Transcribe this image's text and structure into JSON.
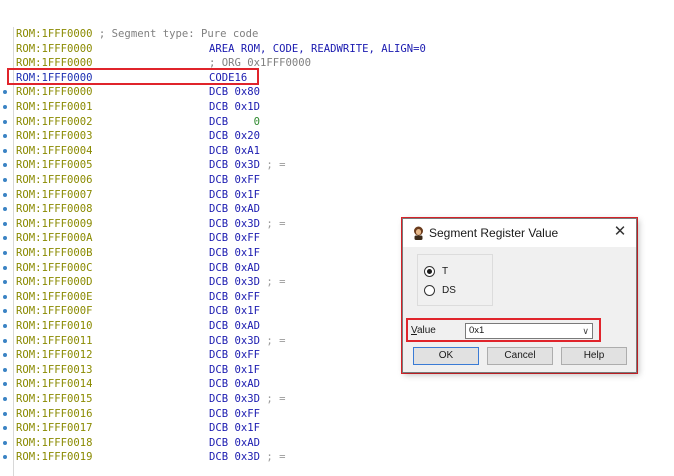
{
  "listing": {
    "lines": [
      {
        "addr": "ROM:1FFF0000",
        "rest_comment": " ; Segment type: ",
        "rest_extra": "Pure code",
        "dot": false
      },
      {
        "addr": "ROM:1FFF0000",
        "mnem": "AREA ROM, CODE, READWRITE, ALIGN=0",
        "dot": false
      },
      {
        "addr": "ROM:1FFF0000",
        "mnem_gray": "; ORG 0x1FFF0000",
        "dot": false
      },
      {
        "addr": "ROM:1FFF0000",
        "mnem": "CODE16",
        "dot": false,
        "selected": true
      },
      {
        "addr": "ROM:1FFF0000",
        "mnem": "DCB",
        "op": "0x80",
        "dot": true
      },
      {
        "addr": "ROM:1FFF0001",
        "mnem": "DCB",
        "op": "0x1D",
        "dot": true
      },
      {
        "addr": "ROM:1FFF0002",
        "mnem": "DCB",
        "op_sp": "   0",
        "dot": true
      },
      {
        "addr": "ROM:1FFF0003",
        "mnem": "DCB",
        "op": "0x20",
        "dot": true
      },
      {
        "addr": "ROM:1FFF0004",
        "mnem": "DCB",
        "op": "0xA1",
        "dot": true
      },
      {
        "addr": "ROM:1FFF0005",
        "mnem": "DCB",
        "op": "0x3D",
        "semi": " ; =",
        "dot": true
      },
      {
        "addr": "ROM:1FFF0006",
        "mnem": "DCB",
        "op": "0xFF",
        "dot": true
      },
      {
        "addr": "ROM:1FFF0007",
        "mnem": "DCB",
        "op": "0x1F",
        "dot": true
      },
      {
        "addr": "ROM:1FFF0008",
        "mnem": "DCB",
        "op": "0xAD",
        "dot": true
      },
      {
        "addr": "ROM:1FFF0009",
        "mnem": "DCB",
        "op": "0x3D",
        "semi": " ; =",
        "dot": true
      },
      {
        "addr": "ROM:1FFF000A",
        "mnem": "DCB",
        "op": "0xFF",
        "dot": true
      },
      {
        "addr": "ROM:1FFF000B",
        "mnem": "DCB",
        "op": "0x1F",
        "dot": true
      },
      {
        "addr": "ROM:1FFF000C",
        "mnem": "DCB",
        "op": "0xAD",
        "dot": true
      },
      {
        "addr": "ROM:1FFF000D",
        "mnem": "DCB",
        "op": "0x3D",
        "semi": " ; =",
        "dot": true
      },
      {
        "addr": "ROM:1FFF000E",
        "mnem": "DCB",
        "op": "0xFF",
        "dot": true
      },
      {
        "addr": "ROM:1FFF000F",
        "mnem": "DCB",
        "op": "0x1F",
        "dot": true
      },
      {
        "addr": "ROM:1FFF0010",
        "mnem": "DCB",
        "op": "0xAD",
        "dot": true
      },
      {
        "addr": "ROM:1FFF0011",
        "mnem": "DCB",
        "op": "0x3D",
        "semi": " ; =",
        "dot": true
      },
      {
        "addr": "ROM:1FFF0012",
        "mnem": "DCB",
        "op": "0xFF",
        "dot": true
      },
      {
        "addr": "ROM:1FFF0013",
        "mnem": "DCB",
        "op": "0x1F",
        "dot": true
      },
      {
        "addr": "ROM:1FFF0014",
        "mnem": "DCB",
        "op": "0xAD",
        "dot": true
      },
      {
        "addr": "ROM:1FFF0015",
        "mnem": "DCB",
        "op": "0x3D",
        "semi": " ; =",
        "dot": true
      },
      {
        "addr": "ROM:1FFF0016",
        "mnem": "DCB",
        "op": "0xFF",
        "dot": true
      },
      {
        "addr": "ROM:1FFF0017",
        "mnem": "DCB",
        "op": "0x1F",
        "dot": true
      },
      {
        "addr": "ROM:1FFF0018",
        "mnem": "DCB",
        "op": "0xAD",
        "dot": true
      },
      {
        "addr": "ROM:1FFF0019",
        "mnem": "DCB",
        "op": "0x3D",
        "semi": " ; =",
        "dot": true
      }
    ]
  },
  "dialog": {
    "title": "Segment Register Value",
    "close_symbol": "✕",
    "radio_t": "T",
    "radio_ds": "DS",
    "selected_radio": "T",
    "value_label_underline": "V",
    "value_label_rest": "alue",
    "value": "0x1",
    "ok": "OK",
    "cancel": "Cancel",
    "help": "Help"
  },
  "colors": {
    "address": "#8a8a00",
    "instruction": "#1b1bb0",
    "highlight": "#e0242b"
  },
  "icons": {
    "title": "ida-app-icon",
    "close": "close-icon",
    "dropdown": "chevron-down-icon"
  }
}
